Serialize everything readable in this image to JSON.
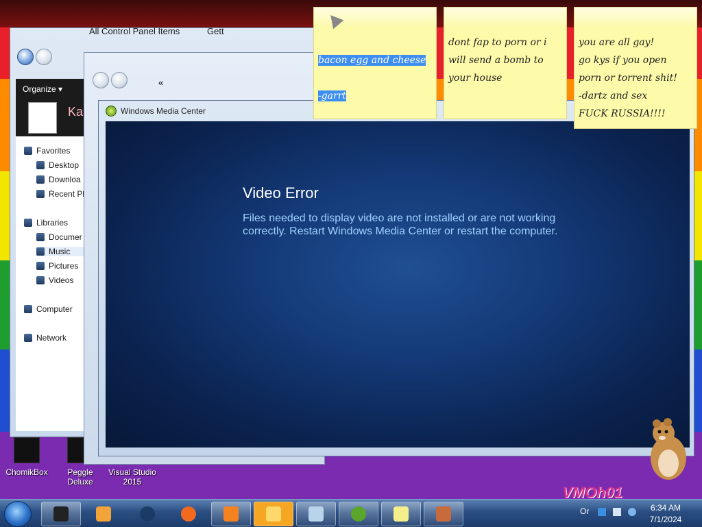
{
  "desktop": {
    "icons": [
      {
        "label": "ChomikBox"
      },
      {
        "label": "Peggle Deluxe"
      },
      {
        "label": "Visual Studio 2015"
      }
    ],
    "watermark": "VMOh01"
  },
  "explorer": {
    "toolbar": {
      "organize": "Organize ▾"
    },
    "user_partial": "Ka",
    "nav": {
      "favorites": "Favorites",
      "desktop": "Desktop",
      "downloads": "Downloa",
      "recent": "Recent Pl",
      "libraries": "Libraries",
      "documents": "Documer",
      "music": "Music",
      "pictures": "Pictures",
      "videos": "Videos",
      "computer": "Computer",
      "network": "Network"
    }
  },
  "control_panel": {
    "breadcrumb": "All Control Panel Items",
    "breadcrumb_sep": "«",
    "next_crumb": "Gett"
  },
  "media_center": {
    "title": "Windows Media Center",
    "error_heading": "Video Error",
    "error_message": "Files needed to display video are not installed or are not working correctly. Restart Windows Media Center or restart the computer."
  },
  "sticky_notes": [
    {
      "line1": "bacon egg and cheese",
      "line2": "-garrt"
    },
    {
      "text": "dont fap to porn or i\nwill send a bomb to\nyour house"
    },
    {
      "text": "you are all gay!\ngo kys if you open\nporn or torrent shit!\n-dartz and sex\nFUCK RUSSIA!!!!"
    }
  ],
  "taskbar": {
    "clock_time": "6:34 AM",
    "clock_date": "7/1/2024",
    "tray_partial": "Or"
  }
}
